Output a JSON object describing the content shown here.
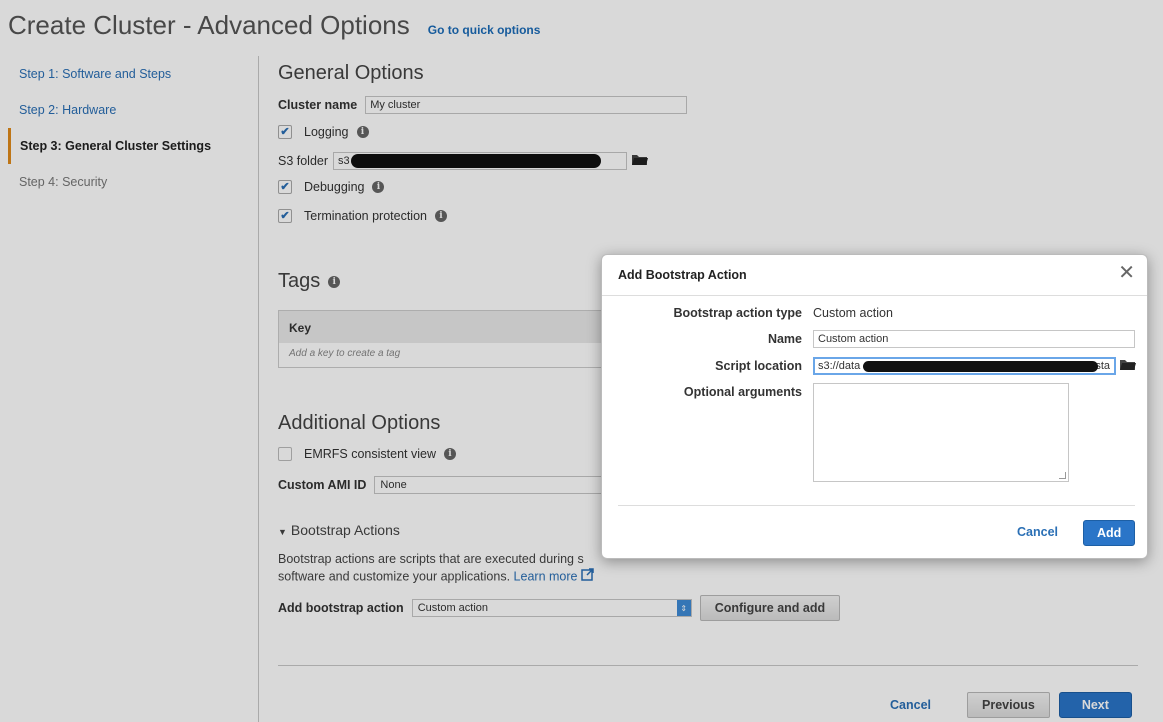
{
  "header": {
    "title": "Create Cluster - Advanced Options",
    "quick_link": "Go to quick options"
  },
  "steps": [
    {
      "label": "Step 1: Software and Steps",
      "state": "link"
    },
    {
      "label": "Step 2: Hardware",
      "state": "link"
    },
    {
      "label": "Step 3: General Cluster Settings",
      "state": "active"
    },
    {
      "label": "Step 4: Security",
      "state": "disabled"
    }
  ],
  "general": {
    "title": "General Options",
    "cluster_name_label": "Cluster name",
    "cluster_name_value": "My cluster",
    "logging_label": "Logging",
    "logging_checked": true,
    "s3_folder_label": "S3 folder",
    "s3_folder_value": "s3",
    "debugging_label": "Debugging",
    "debugging_checked": true,
    "termination_label": "Termination protection",
    "termination_checked": true
  },
  "tags": {
    "title": "Tags",
    "key_header": "Key",
    "key_placeholder": "Add a key to create a tag"
  },
  "additional": {
    "title": "Additional Options",
    "emrfs_label": "EMRFS consistent view",
    "emrfs_checked": false,
    "ami_label": "Custom AMI ID",
    "ami_value": "None"
  },
  "bootstrap": {
    "toggle_label": "Bootstrap Actions",
    "description_start": "Bootstrap actions are scripts that are executed during s",
    "description_end": "software and customize your applications.",
    "learn_more": "Learn more",
    "add_label": "Add bootstrap action",
    "add_value": "Custom action",
    "configure_button": "Configure and add"
  },
  "footer": {
    "cancel": "Cancel",
    "previous": "Previous",
    "next": "Next"
  },
  "modal": {
    "title": "Add Bootstrap Action",
    "type_label": "Bootstrap action type",
    "type_value": "Custom action",
    "name_label": "Name",
    "name_value": "Custom action",
    "script_label": "Script location",
    "script_value_start": "s3://data",
    "script_value_end": "sta",
    "args_label": "Optional arguments",
    "cancel": "Cancel",
    "add": "Add"
  },
  "icons": {
    "info": "info-icon",
    "folder": "folder-icon",
    "close": "close-icon",
    "external_link": "external-link-icon",
    "triangle": "caret-down-icon"
  },
  "colors": {
    "link": "#2a6fb5",
    "primary_button": "#2a75c8",
    "active_step_marker": "#e08a1b",
    "select_arrow": "#3f8bd6"
  }
}
